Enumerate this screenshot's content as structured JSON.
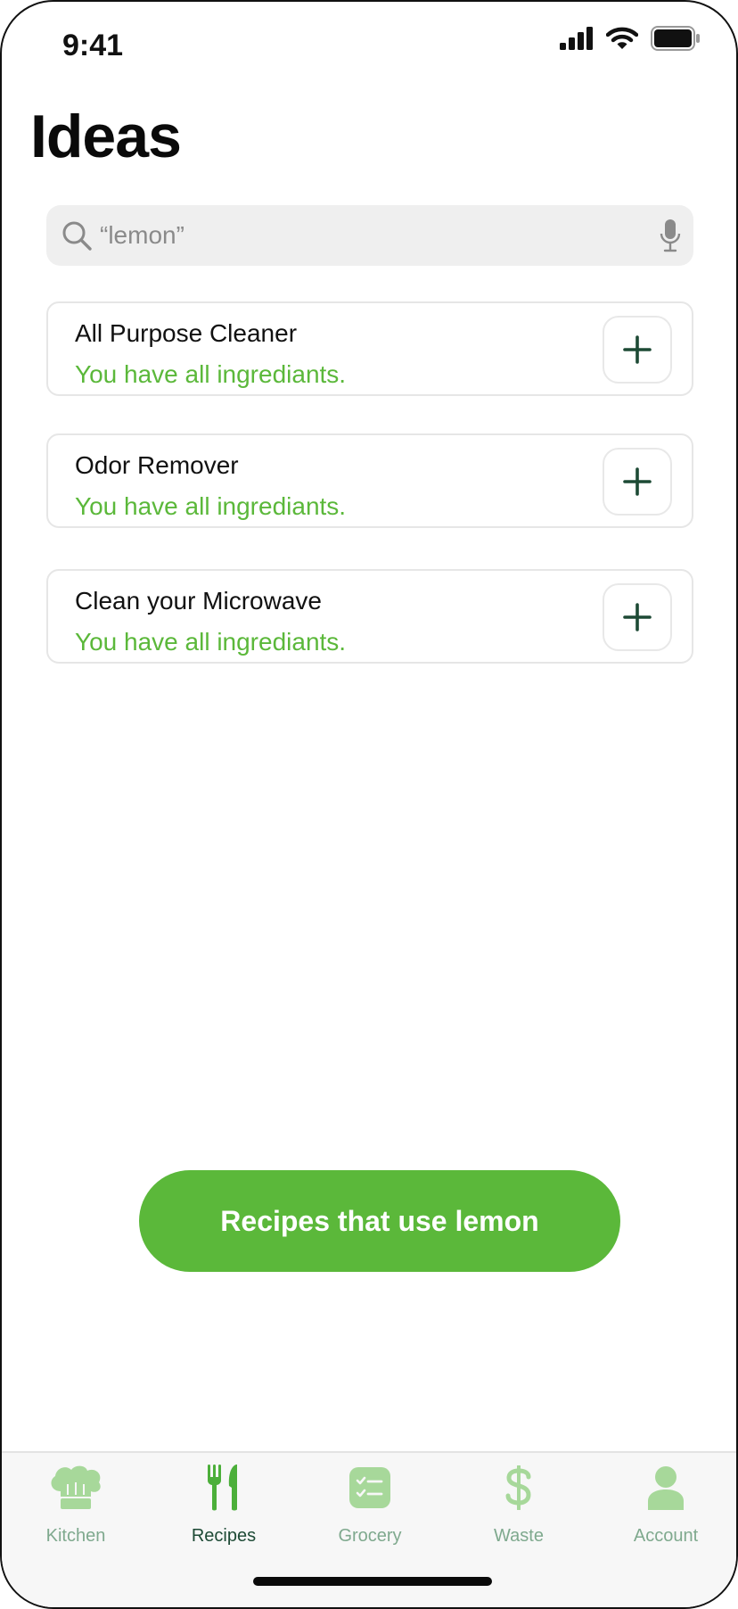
{
  "status_bar": {
    "time": "9:41"
  },
  "title": "Ideas",
  "search": {
    "value": "“lemon”"
  },
  "ideas": [
    {
      "title": "All Purpose Cleaner",
      "status": "You have all ingrediants."
    },
    {
      "title": "Odor Remover",
      "status": "You have all ingrediants."
    },
    {
      "title": "Clean your Microwave",
      "status": "You have all ingrediants."
    }
  ],
  "cta": {
    "label": "Recipes that use lemon"
  },
  "tabs": [
    {
      "label": "Kitchen",
      "icon": "chef-hat-icon",
      "active": false
    },
    {
      "label": "Recipes",
      "icon": "fork-knife-icon",
      "active": true
    },
    {
      "label": "Grocery",
      "icon": "checklist-icon",
      "active": false
    },
    {
      "label": "Waste",
      "icon": "dollar-icon",
      "active": false
    },
    {
      "label": "Account",
      "icon": "person-icon",
      "active": false
    }
  ],
  "colors": {
    "accent": "#5bb83a",
    "tab_inactive": "#a7d89a",
    "tab_active": "#4caf3a",
    "dark_green": "#1d4a35"
  }
}
